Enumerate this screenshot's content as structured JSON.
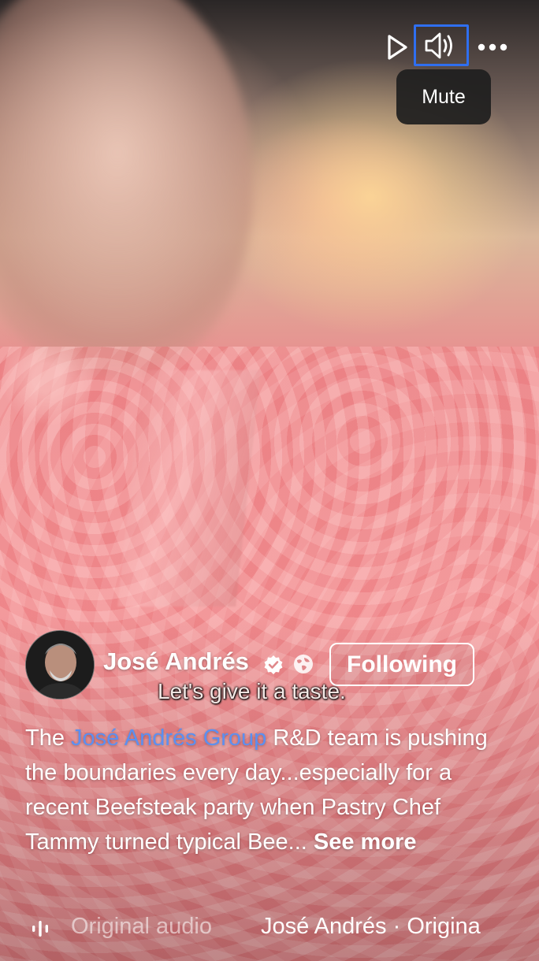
{
  "video": {
    "subtitle": "Let's give it a taste."
  },
  "controls": {
    "play_icon": "play-icon",
    "sound_icon": "speaker-icon",
    "more_icon": "more-icon",
    "tooltip": "Mute",
    "focus_color": "#2f6ff0"
  },
  "author": {
    "name": "José Andrés",
    "verified_icon": "verified-badge-icon",
    "privacy_icon": "globe-icon",
    "follow_label": "Following"
  },
  "caption": {
    "prefix": "The ",
    "mention": "José Andrés Group",
    "body": " R&D team is pushing the boundaries every day...especially for a recent Beefsteak party when Pastry Chef Tammy turned typical Bee... ",
    "see_more": "See more",
    "mention_color": "#5c8ff0"
  },
  "audio": {
    "icon": "audio-wave-icon",
    "label": "Original audio",
    "credit": "José Andrés · Origina"
  }
}
